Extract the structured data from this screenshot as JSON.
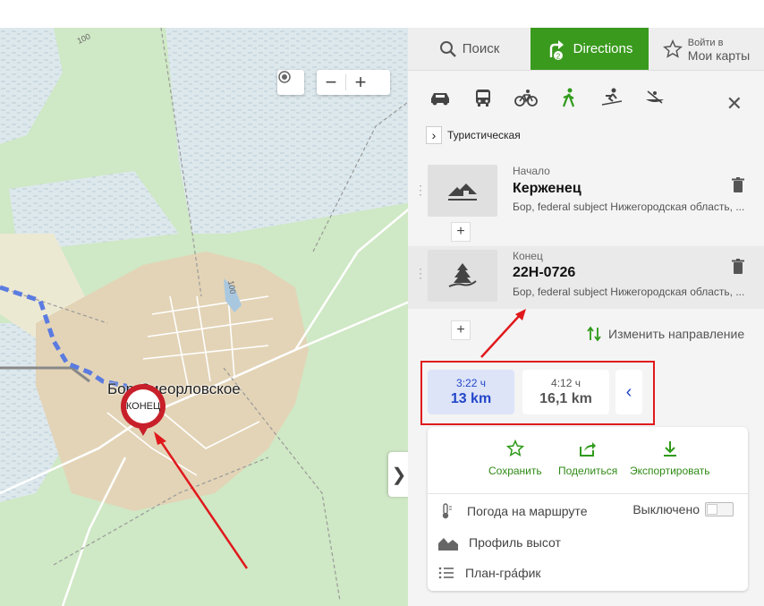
{
  "map": {
    "town_label": "Бор-Сиеорловское",
    "end_marker_label": "КОНЕЦ",
    "road_labels": [
      "100",
      "100"
    ],
    "zoom_in": "+",
    "zoom_out": "−",
    "locate_icon": "target-icon",
    "collapse_icon": "chevron-right-icon"
  },
  "panel": {
    "tabs": {
      "search": "Поиск",
      "directions": "Directions",
      "login_small": "Войти в",
      "login_big": "Мои карты"
    },
    "modes": [
      "car-icon",
      "bus-icon",
      "bicycle-icon",
      "walk-icon",
      "ski-icon",
      "boat-icon"
    ],
    "routing_profile": "Туристическая",
    "waypoints": [
      {
        "caption": "Начало",
        "name": "Керженец",
        "address": "Бор, federal subject Нижегородская область, ..."
      },
      {
        "caption": "Конец",
        "name": "22Н-0726",
        "address": "Бор, federal subject Нижегородская область, ..."
      }
    ],
    "reverse_label": "Изменить направление",
    "routes": [
      {
        "time": "3:22 ч",
        "distance": "13 km"
      },
      {
        "time": "4:12 ч",
        "distance": "16,1 km"
      }
    ],
    "actions": {
      "save": "Сохранить",
      "share": "Поделиться",
      "export": "Экспортировать"
    },
    "options": {
      "weather": "Погода на маршруте",
      "weather_state": "Выключено",
      "elevation": "Профиль высот",
      "schedule": "План-гра́фик"
    }
  },
  "colors": {
    "accent_green": "#3a9a1e",
    "route_blue": "#2346c8",
    "annotation_red": "#e0191c",
    "marker_red": "#c8202a"
  }
}
